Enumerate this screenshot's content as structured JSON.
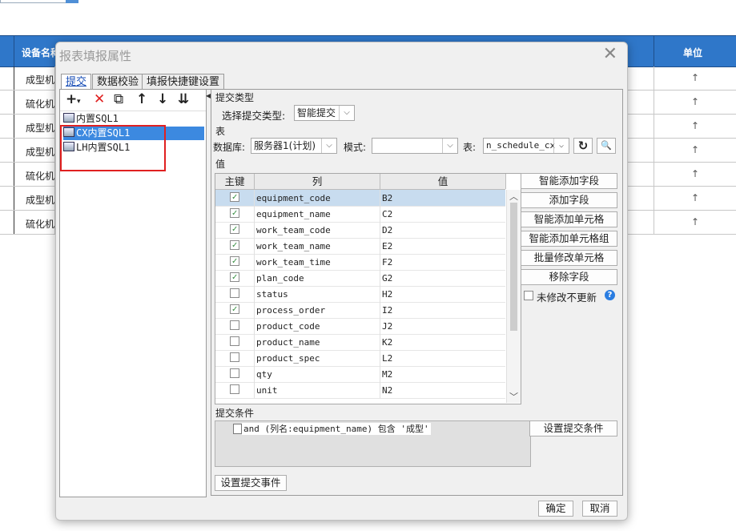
{
  "background": {
    "header": {
      "device_name": "设备名称",
      "unit": "单位"
    },
    "rows": [
      {
        "name": "成型机",
        "unit_arrow": "↑"
      },
      {
        "name": "硫化机",
        "unit_arrow": "↑"
      },
      {
        "name": "成型机",
        "unit_arrow": "↑"
      },
      {
        "name": "成型机",
        "unit_arrow": "↑"
      },
      {
        "name": "硫化机",
        "unit_arrow": "↑"
      },
      {
        "name": "成型机",
        "unit_arrow": "↑"
      },
      {
        "name": "硫化机",
        "unit_arrow": "↑"
      }
    ]
  },
  "dialog": {
    "title": "报表填报属性",
    "close": "✕",
    "tabs": [
      "提交",
      "数据校验",
      "填报快捷键设置"
    ],
    "toolbar": {
      "add": "+",
      "add_caret": "▾",
      "delete": "✕",
      "copy": "⧉",
      "up": "↑",
      "down": "↓",
      "sort": "⇊"
    },
    "tree": [
      {
        "label": "内置SQL1"
      },
      {
        "label": "CX内置SQL1"
      },
      {
        "label": "LH内置SQL1"
      }
    ],
    "submit_type": {
      "section": "提交类型",
      "label": "选择提交类型:",
      "value": "智能提交"
    },
    "table_section": {
      "section": "表",
      "db_label": "数据库:",
      "db_value": "服务器1(计划)",
      "mode_label": "模式:",
      "mode_value": "",
      "table_label": "表:",
      "table_value": "n_schedule_cx",
      "refresh": "↻",
      "preview": "🔍"
    },
    "value_section": {
      "section": "值",
      "headers": {
        "key": "主键",
        "column": "列",
        "value": "值"
      },
      "rows": [
        {
          "checked": true,
          "column": "equipment_code",
          "value": "B2"
        },
        {
          "checked": true,
          "column": "equipment_name",
          "value": "C2"
        },
        {
          "checked": true,
          "column": "work_team_code",
          "value": "D2"
        },
        {
          "checked": true,
          "column": "work_team_name",
          "value": "E2"
        },
        {
          "checked": true,
          "column": "work_team_time",
          "value": "F2"
        },
        {
          "checked": true,
          "column": "plan_code",
          "value": "G2"
        },
        {
          "checked": false,
          "column": "status",
          "value": "H2"
        },
        {
          "checked": true,
          "column": "process_order",
          "value": "I2"
        },
        {
          "checked": false,
          "column": "product_code",
          "value": "J2"
        },
        {
          "checked": false,
          "column": "product_name",
          "value": "K2"
        },
        {
          "checked": false,
          "column": "product_spec",
          "value": "L2"
        },
        {
          "checked": false,
          "column": "qty",
          "value": "M2"
        },
        {
          "checked": false,
          "column": "unit",
          "value": "N2"
        }
      ],
      "buttons": [
        "智能添加字段",
        "添加字段",
        "智能添加单元格",
        "智能添加单元格组",
        "批量修改单元格",
        "移除字段"
      ],
      "no_update_label": "未修改不更新",
      "help": "?"
    },
    "condition": {
      "section": "提交条件",
      "text": "and (列名:equipment_name) 包含 '成型'",
      "button": "设置提交条件"
    },
    "event_button": "设置提交事件",
    "ok": "确定",
    "cancel": "取消"
  }
}
